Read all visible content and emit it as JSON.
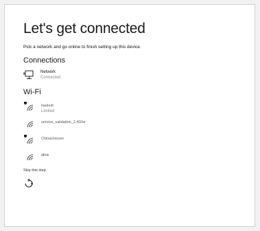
{
  "header": {
    "title": "Let's get connected",
    "subtitle": "Pick a network and go online to finish setting up this device."
  },
  "connections": {
    "heading": "Connections",
    "network": {
      "name": "Network",
      "status": "Connected",
      "icon": "ethernet-icon"
    }
  },
  "wifi": {
    "heading": "Wi-Fi",
    "networks": [
      {
        "name": "haoledi",
        "status": "Limited",
        "secured": true
      },
      {
        "name": "service_validation_2.4Ghz",
        "status": "",
        "secured": false
      },
      {
        "name": "ChinaUnicom",
        "status": "",
        "secured": true
      },
      {
        "name": "dlink",
        "status": "",
        "secured": false
      }
    ]
  },
  "footer": {
    "skip_label": "Skip this step",
    "accessibility_icon": "accessibility-icon"
  }
}
